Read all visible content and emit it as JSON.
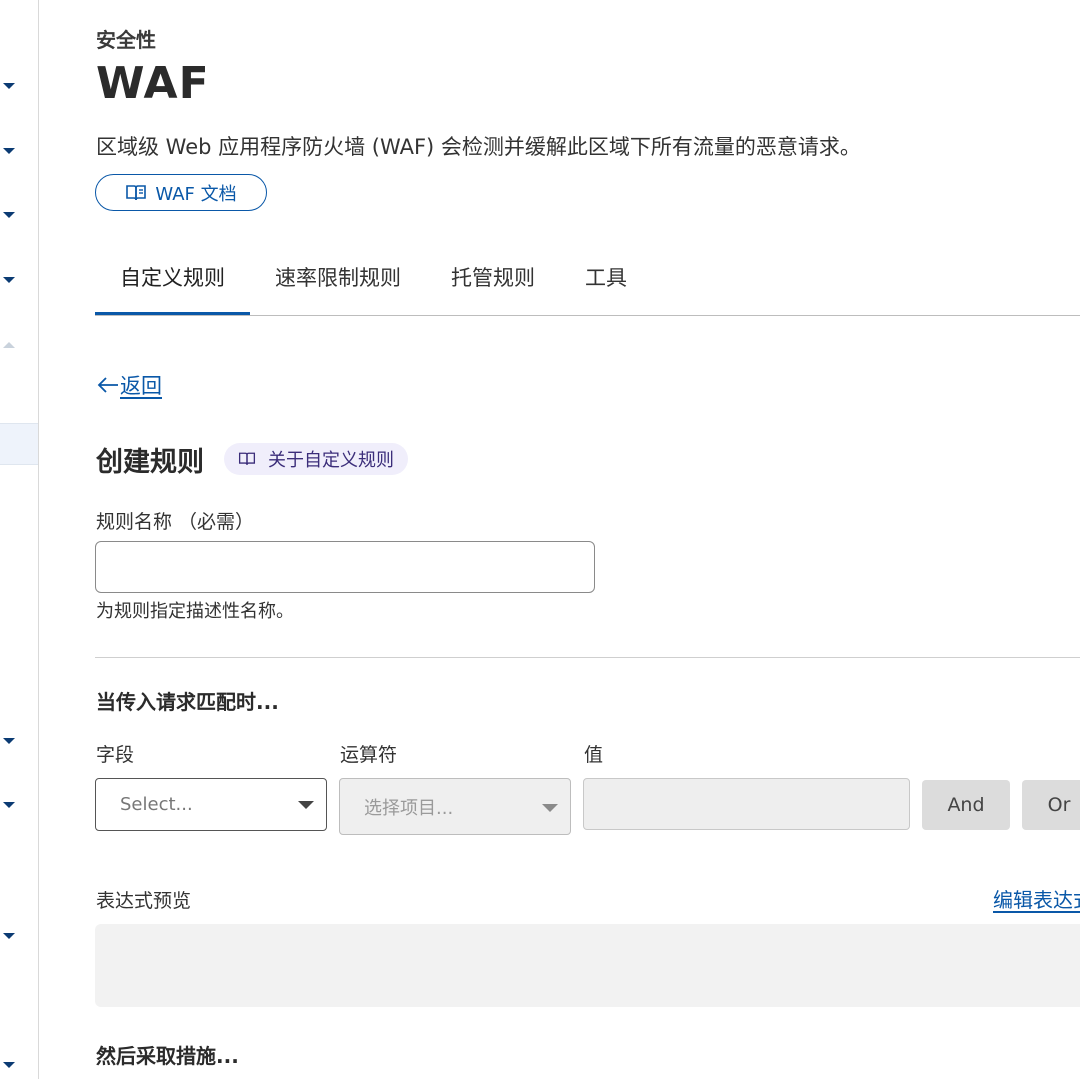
{
  "sidebar": {
    "chevrons": [
      {
        "dir": "down"
      },
      {
        "dir": "down"
      },
      {
        "dir": "down"
      },
      {
        "dir": "down"
      },
      {
        "dir": "up"
      },
      {
        "dir": "down"
      },
      {
        "dir": "down"
      },
      {
        "dir": "down"
      },
      {
        "dir": "down"
      }
    ]
  },
  "header": {
    "breadcrumb": "安全性",
    "title": "WAF",
    "description": "区域级 Web 应用程序防火墙 (WAF) 会检测并缓解此区域下所有流量的恶意请求。",
    "doc_button": "WAF 文档"
  },
  "tabs": [
    {
      "label": "自定义规则",
      "active": true
    },
    {
      "label": "速率限制规则",
      "active": false
    },
    {
      "label": "托管规则",
      "active": false
    },
    {
      "label": "工具",
      "active": false
    }
  ],
  "back_link": "返回",
  "form": {
    "heading": "创建规则",
    "about_pill": "关于自定义规则",
    "rule_name_label": "规则名称 （必需）",
    "rule_name_value": "",
    "rule_name_hint": "为规则指定描述性名称。",
    "match_heading": "当传入请求匹配时...",
    "field_label": "字段",
    "operator_label": "运算符",
    "value_label": "值",
    "field_placeholder": "Select...",
    "operator_placeholder": "选择项目...",
    "and_button": "And",
    "or_button": "Or",
    "preview_label": "表达式预览",
    "edit_expression_link": "编辑表达式",
    "action_heading": "然后采取措施..."
  },
  "colors": {
    "accent": "#0a58a8",
    "pill_bg": "#f0eefb",
    "sidebar_icon": "#0b3b73"
  }
}
